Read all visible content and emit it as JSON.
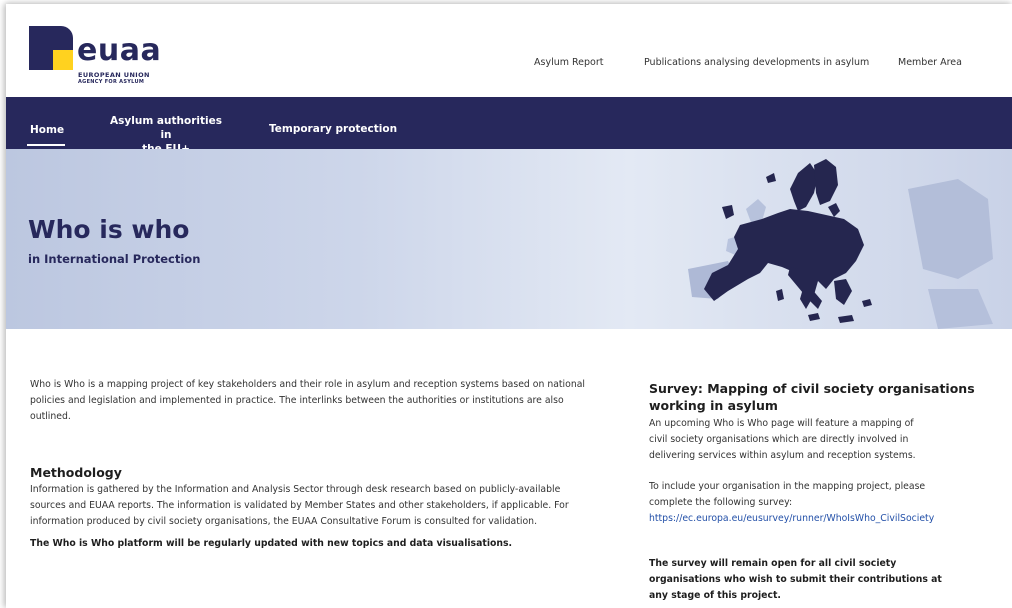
{
  "logo": {
    "wordmark": "euaa",
    "line1": "EUROPEAN UNION",
    "line2": "AGENCY FOR ASYLUM"
  },
  "top_nav": [
    "Asylum Report",
    "Publications analysing developments in asylum",
    "Member Area"
  ],
  "main_nav": {
    "home": "Home",
    "asylum_line1": "Asylum authorities in",
    "asylum_line2": "the EU+",
    "temporary": "Temporary protection"
  },
  "hero": {
    "title": "Who is who",
    "subtitle": "in International Protection"
  },
  "intro": [
    "Who is Who is a mapping project of key stakeholders and their role in asylum and reception systems based on national",
    "policies and legislation and implemented in practice. The interlinks between the authorities or institutions are also",
    "outlined."
  ],
  "methodology": {
    "heading": "Methodology",
    "lines": [
      "Information is gathered by the Information and Analysis Sector through desk research based on publicly-available",
      "sources and EUAA reports. The information is validated by Member States and other stakeholders, if applicable. For",
      "information produced by civil society organisations, the EUAA Consultative Forum is consulted for validation."
    ],
    "update_note": "The Who is Who platform will be regularly updated with new topics and data visualisations."
  },
  "survey": {
    "heading_line1": "Survey: Mapping of civil society organisations",
    "heading_line2": "working in asylum",
    "para1": [
      "An upcoming Who is Who page will feature a mapping of",
      "civil society organisations which are directly involved in",
      "delivering services within asylum and reception systems."
    ],
    "para2": [
      "To include your organisation in the mapping project, please",
      "complete the following survey:"
    ],
    "link": "https://ec.europa.eu/eusurvey/runner/WhoIsWho_CivilSociety",
    "closing": [
      "The survey will remain open for all civil society",
      "organisations who wish to submit their contributions at",
      "any stage of this project."
    ]
  },
  "colors": {
    "navy": "#27285c",
    "yellow": "#ffd21f",
    "link": "#2350a8"
  }
}
